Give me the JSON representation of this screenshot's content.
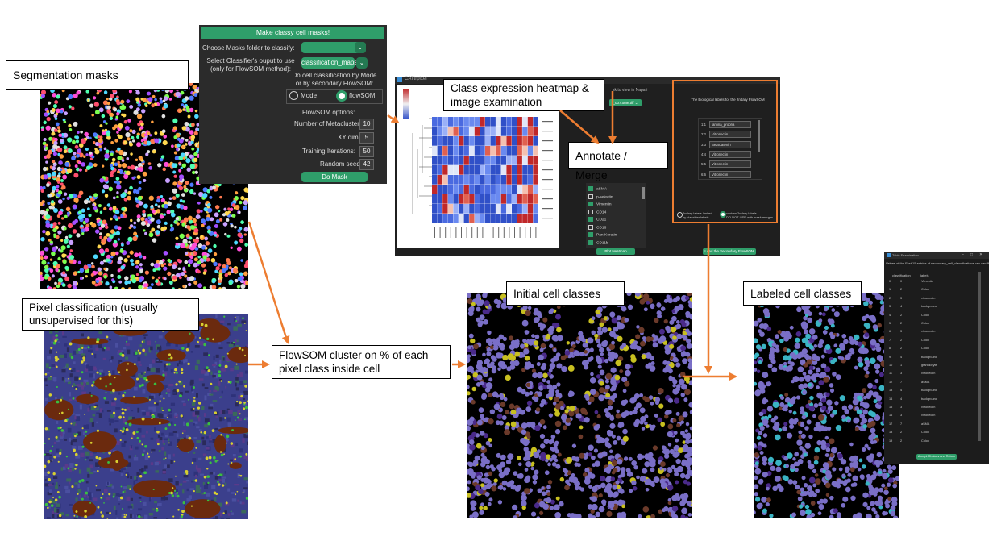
{
  "callouts": {
    "segmentation": "Segmentation masks",
    "pixel_classification": "Pixel classification (usually unsupervised for this)",
    "flowsom": "FlowSOM cluster on % of each pixel class inside cell",
    "heatmap": "Class expression heatmap & image examination",
    "annotate": "Annotate / Merge",
    "initial": "Initial cell classes",
    "labeled": "Labeled cell classes"
  },
  "options_panel": {
    "header_button": "Make classy cell masks!",
    "masks_folder_label": "Choose Masks folder to classify:",
    "masks_folder_value": "",
    "classifier_output_label": "Select Classifier's ouput to use\n(only for FlowSOM method):",
    "classifier_output_value": "classification_maps",
    "method_question": "Do cell classification by Mode\nor by secondary FlowSOM:",
    "mode_label": "Mode",
    "flowsom_label": "flowSOM",
    "flowsom_options_title": "FlowSOM options:",
    "params": [
      {
        "label": "Number of Metaclusters:",
        "value": "10"
      },
      {
        "label": "XY dims:",
        "value": "5"
      },
      {
        "label": "Training Iterations:",
        "value": "50"
      },
      {
        "label": "Random seed:",
        "value": "42"
      }
    ],
    "run_button": "Do Mask Classification!",
    "chevron_icon": "chevron-down-icon"
  },
  "heatmap_window": {
    "title": "CATtrpixel",
    "view_label": "sk to view in Napari",
    "view_select": "_007.ome.tiff",
    "markers": [
      {
        "name": "aSMA",
        "checked": true
      },
      {
        "name": "p-selectin",
        "checked": false
      },
      {
        "name": "Vimentin",
        "checked": true
      },
      {
        "name": "CD14",
        "checked": false
      },
      {
        "name": "CD21",
        "checked": true
      },
      {
        "name": "CD16",
        "checked": false
      },
      {
        "name": "Pan-Keratin",
        "checked": true
      },
      {
        "name": "CD11b",
        "checked": true
      }
    ],
    "plot_button": "Plot Heatmap",
    "load_button": "Load the Secondary FlowSOM",
    "bio_labels_title": "The Biological labels for the 2ndary FlowSOM",
    "bio_labels": [
      {
        "id": "1:1",
        "label": "lamina_propria"
      },
      {
        "id": "2:2",
        "label": "Vitronectin"
      },
      {
        "id": "3:3",
        "label": "BetaCatenin"
      },
      {
        "id": "4:4",
        "label": "Vitronectin"
      },
      {
        "id": "5:5",
        "label": "Vitronectin"
      },
      {
        "id": "6:6",
        "label": "Vitronectin"
      }
    ],
    "radio_limited": "2ndary labels limited\nby classifier labels",
    "radio_custom": "custom 2ndary labels\nDO NOT USE with mask merges"
  },
  "table_window": {
    "title": "Table Examination",
    "subtitle": "Values of the First 15 entries of secondary_cell_classifications.csv can file",
    "columns": [
      "classification",
      "labels"
    ],
    "rows": [
      [
        "0",
        "0",
        "Vimentin"
      ],
      [
        "1",
        "2",
        "Colon"
      ],
      [
        "2",
        "3",
        "vitronectin"
      ],
      [
        "3",
        "4",
        "background"
      ],
      [
        "4",
        "2",
        "Colon"
      ],
      [
        "5",
        "2",
        "Colon"
      ],
      [
        "6",
        "3",
        "vitronectin"
      ],
      [
        "7",
        "2",
        "Colon"
      ],
      [
        "8",
        "2",
        "Colon"
      ],
      [
        "9",
        "4",
        "background"
      ],
      [
        "10",
        "1",
        "granulocyte"
      ],
      [
        "11",
        "3",
        "vitronectin"
      ],
      [
        "12",
        "7",
        "aSMA"
      ],
      [
        "13",
        "4",
        "background"
      ],
      [
        "14",
        "4",
        "background"
      ],
      [
        "15",
        "3",
        "vitronectin"
      ],
      [
        "16",
        "3",
        "vitronectin"
      ],
      [
        "17",
        "7",
        "aSMA"
      ],
      [
        "18",
        "2",
        "Colon"
      ],
      [
        "19",
        "2",
        "Colon"
      ]
    ],
    "accept_button": "Accept Choices and Return"
  },
  "colors": {
    "accent_orange": "#ed7d31",
    "panel_green": "#2f9e6a",
    "cell_purple": "#7a6fc7",
    "labeled_cyan": "#3ab4c4"
  }
}
